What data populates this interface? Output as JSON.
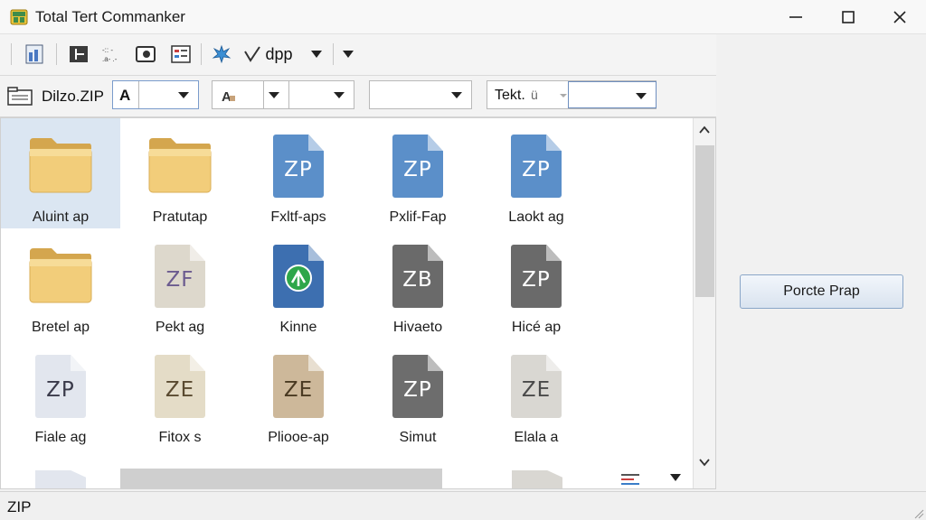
{
  "window": {
    "title": "Total Tert Commanker"
  },
  "toolbar": {
    "dpp_label": "dpp"
  },
  "address": {
    "path_label": "Dilzo.ZIP",
    "drive_letter": "A",
    "combo3_letter": "Tekt.",
    "combo3_glyph": "ü"
  },
  "files": [
    {
      "label": "Aluint ap",
      "kind": "folder",
      "selected": true
    },
    {
      "label": "Pratutap",
      "kind": "folder"
    },
    {
      "label": "Fxltf-aps",
      "kind": "doc",
      "text": "ZP",
      "color": "#5b8fc9"
    },
    {
      "label": "Pxlif-Fap",
      "kind": "doc",
      "text": "ZP",
      "color": "#5b8fc9"
    },
    {
      "label": "Laokt ag",
      "kind": "doc",
      "text": "ZP",
      "color": "#5b8fc9"
    },
    {
      "label": "Bretel ap",
      "kind": "folder"
    },
    {
      "label": "Pekt ag",
      "kind": "doc",
      "text": "ZF",
      "color": "#ddd8cc",
      "textColor": "#6b5b8f"
    },
    {
      "label": "Kinne",
      "kind": "doc",
      "text": "",
      "color": "#3d6fb0",
      "special": "green"
    },
    {
      "label": "Hivaeto",
      "kind": "doc",
      "text": "ZB",
      "color": "#6a6a6a"
    },
    {
      "label": "Hicé ap",
      "kind": "doc",
      "text": "ZP",
      "color": "#6a6a6a"
    },
    {
      "label": "Fiale ag",
      "kind": "doc",
      "text": "ZP",
      "color": "#e2e6ee",
      "textColor": "#3a3a4a"
    },
    {
      "label": "Fitox s",
      "kind": "doc",
      "text": "ZE",
      "color": "#e4dcc7",
      "textColor": "#5a4a30"
    },
    {
      "label": "Pliooe-ap",
      "kind": "doc",
      "text": "ZE",
      "color": "#cdb89a",
      "textColor": "#4a3a22"
    },
    {
      "label": "Simut",
      "kind": "doc",
      "text": "ZP",
      "color": "#6d6d6d"
    },
    {
      "label": "Elala a",
      "kind": "doc",
      "text": "ZE",
      "color": "#d9d7d2",
      "textColor": "#4a4a4a"
    }
  ],
  "right_panel": {
    "button_label": "Porcte Prap"
  },
  "status": {
    "text": "ZIP"
  }
}
